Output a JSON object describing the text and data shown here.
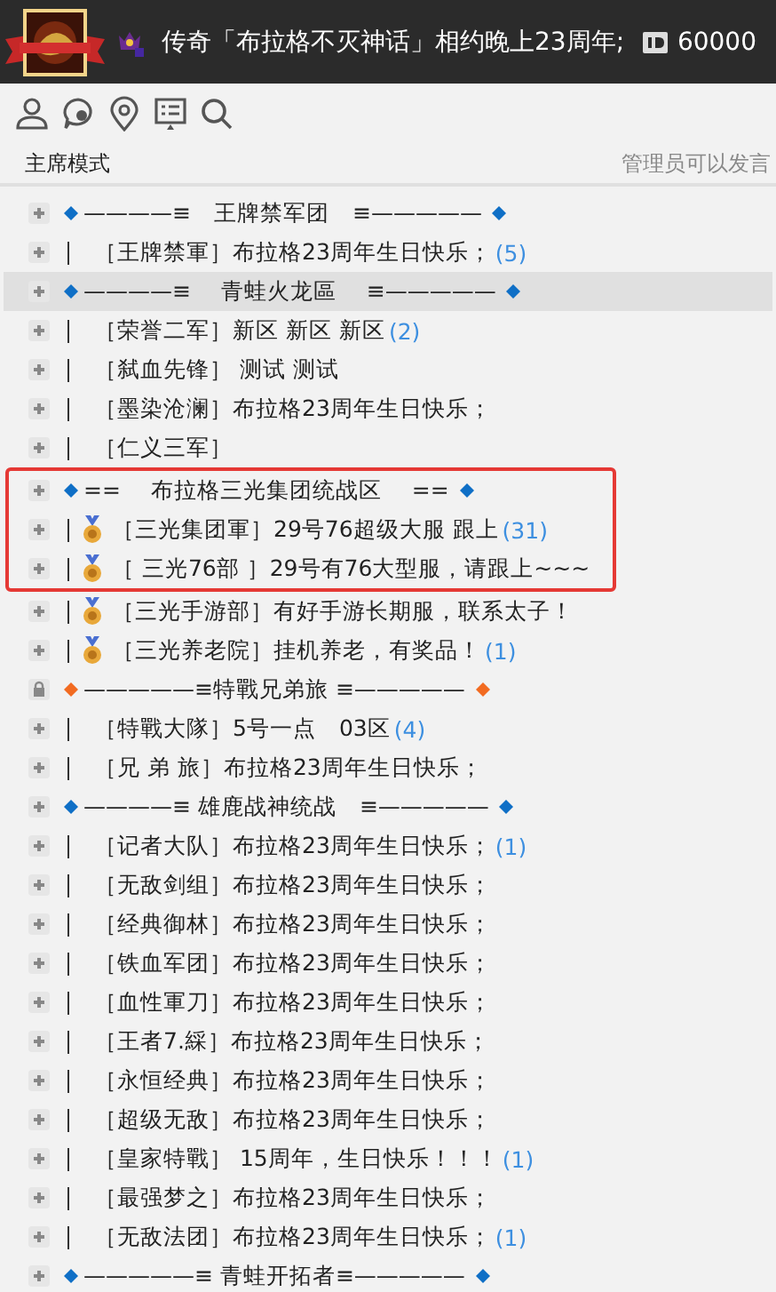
{
  "header": {
    "title": "传奇「布拉格不灭神话」相约晚上23周年;",
    "id_number": "60000"
  },
  "mode_bar": {
    "mode": "主席模式",
    "notice": "管理员可以发言"
  },
  "rows": [
    {
      "kind": "header",
      "text": "————≡　王牌禁军团　≡—————",
      "color": "#0f6fc6",
      "locked": false,
      "selected": false,
      "outlined": false
    },
    {
      "kind": "channel",
      "name": "［王牌禁軍］",
      "text": "布拉格23周年生日快乐；",
      "count": "(5)",
      "medal": false,
      "selected": false,
      "outlined": false
    },
    {
      "kind": "header",
      "text": "————≡　 青蛙火龙區　 ≡—————",
      "color": "#0f6fc6",
      "locked": false,
      "selected": true,
      "outlined": false
    },
    {
      "kind": "channel",
      "name": "［荣誉二军］",
      "text": "新区 新区 新区",
      "count": "(2)",
      "medal": false,
      "selected": false,
      "outlined": false
    },
    {
      "kind": "channel",
      "name": "［弑血先锋］",
      "text": " 测试 测试",
      "medal": false,
      "selected": false,
      "outlined": false
    },
    {
      "kind": "channel",
      "name": "［墨染沧澜］",
      "text": "布拉格23周年生日快乐；",
      "medal": false,
      "selected": false,
      "outlined": false
    },
    {
      "kind": "channel",
      "name": "［仁义三军］",
      "medal": false,
      "selected": false,
      "outlined": false
    },
    {
      "kind": "header",
      "text": "==　 布拉格三光集团统战区　 ==",
      "color": "#0f6fc6",
      "locked": false,
      "selected": false,
      "outlined": true
    },
    {
      "kind": "channel",
      "name": "［三光集团軍］",
      "text": "29号76超级大服 跟上",
      "count": "(31)",
      "medal": true,
      "selected": false,
      "outlined": true
    },
    {
      "kind": "channel",
      "name": "［ 三光76部 ］",
      "text": "29号有76大型服，请跟上~~~",
      "medal": true,
      "selected": false,
      "outlined": true
    },
    {
      "kind": "channel",
      "name": "［三光手游部］",
      "text": "有好手游长期服，联系太子！",
      "medal": true,
      "selected": false,
      "outlined": false
    },
    {
      "kind": "channel",
      "name": "［三光养老院］",
      "text": "挂机养老，有奖品！",
      "count": "(1)",
      "medal": true,
      "selected": false,
      "outlined": false
    },
    {
      "kind": "header",
      "text": "—————≡特戰兄弟旅 ≡—————",
      "color": "#f26b21",
      "locked": true,
      "selected": false,
      "outlined": false
    },
    {
      "kind": "channel",
      "name": "［特戰大隊］",
      "text": "5号一点　03区",
      "count": "(4)",
      "medal": false,
      "selected": false,
      "outlined": false
    },
    {
      "kind": "channel",
      "name": "［兄 弟 旅］",
      "text": "布拉格23周年生日快乐；",
      "medal": false,
      "selected": false,
      "outlined": false
    },
    {
      "kind": "header",
      "text": "————≡ 雄鹿战神统战　≡—————",
      "color": "#0f6fc6",
      "locked": false,
      "selected": false,
      "outlined": false
    },
    {
      "kind": "channel",
      "name": "［记者大队］",
      "text": "布拉格23周年生日快乐；",
      "count": "(1)",
      "medal": false,
      "selected": false,
      "outlined": false
    },
    {
      "kind": "channel",
      "name": "［无敌剑组］",
      "text": "布拉格23周年生日快乐；",
      "medal": false,
      "selected": false,
      "outlined": false
    },
    {
      "kind": "channel",
      "name": "［经典御林］",
      "text": "布拉格23周年生日快乐；",
      "medal": false,
      "selected": false,
      "outlined": false
    },
    {
      "kind": "channel",
      "name": "［铁血军团］",
      "text": "布拉格23周年生日快乐；",
      "medal": false,
      "selected": false,
      "outlined": false
    },
    {
      "kind": "channel",
      "name": "［血性軍刀］",
      "text": "布拉格23周年生日快乐；",
      "medal": false,
      "selected": false,
      "outlined": false
    },
    {
      "kind": "channel",
      "name": "［王者7.綵］",
      "text": "布拉格23周年生日快乐；",
      "medal": false,
      "selected": false,
      "outlined": false
    },
    {
      "kind": "channel",
      "name": "［永恒经典］",
      "text": "布拉格23周年生日快乐；",
      "medal": false,
      "selected": false,
      "outlined": false
    },
    {
      "kind": "channel",
      "name": "［超级无敌］",
      "text": "布拉格23周年生日快乐；",
      "medal": false,
      "selected": false,
      "outlined": false
    },
    {
      "kind": "channel",
      "name": "［皇家特戰］",
      "text": " 15周年，生日快乐！！！",
      "count": "(1)",
      "medal": false,
      "selected": false,
      "outlined": false
    },
    {
      "kind": "channel",
      "name": "［最强梦之］",
      "text": "布拉格23周年生日快乐；",
      "medal": false,
      "selected": false,
      "outlined": false
    },
    {
      "kind": "channel",
      "name": "［无敌法团］",
      "text": "布拉格23周年生日快乐；",
      "count": "(1)",
      "medal": false,
      "selected": false,
      "outlined": false
    },
    {
      "kind": "header",
      "text": "—————≡ 青蛙开拓者≡—————",
      "color": "#0f6fc6",
      "locked": false,
      "selected": false,
      "outlined": false
    }
  ]
}
